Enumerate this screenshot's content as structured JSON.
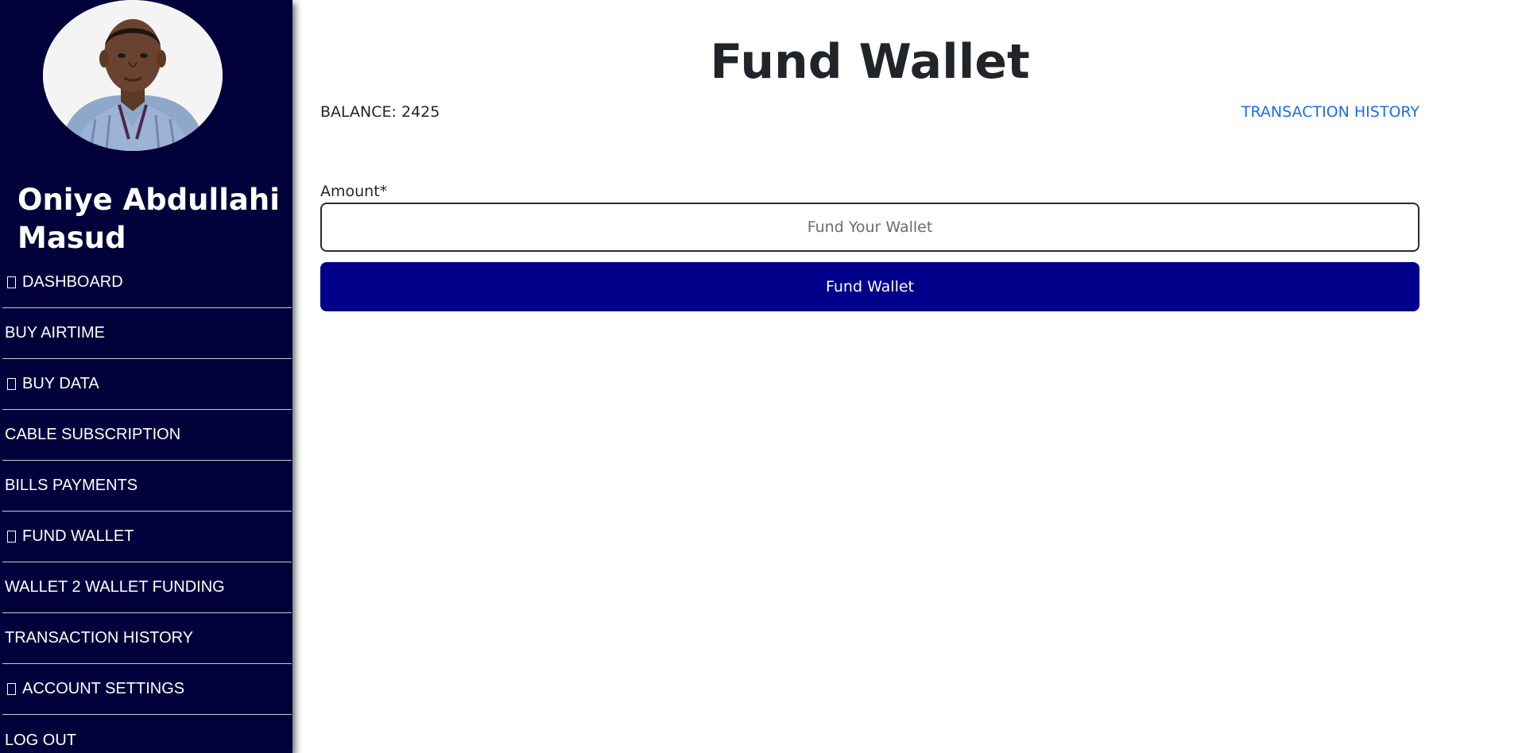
{
  "sidebar": {
    "user_name": "Oniye Abdullahi Masud",
    "colors": {
      "background": "#02003a",
      "text": "#ffffff"
    },
    "items": [
      {
        "label": "DASHBOARD",
        "icon": "missing-glyph-icon"
      },
      {
        "label": "BUY AIRTIME",
        "icon": null
      },
      {
        "label": "BUY DATA",
        "icon": "missing-glyph-icon"
      },
      {
        "label": "CABLE SUBSCRIPTION",
        "icon": null
      },
      {
        "label": "BILLS PAYMENTS",
        "icon": null
      },
      {
        "label": "FUND WALLET",
        "icon": "missing-glyph-icon"
      },
      {
        "label": "WALLET 2 WALLET FUNDING",
        "icon": null
      },
      {
        "label": "TRANSACTION HISTORY",
        "icon": null
      },
      {
        "label": "ACCOUNT SETTINGS",
        "icon": "missing-glyph-icon"
      },
      {
        "label": "LOG OUT",
        "icon": null
      }
    ]
  },
  "main": {
    "title": "Fund Wallet",
    "balance_label": "BALANCE:",
    "balance_value": "2425",
    "transaction_history_link": "TRANSACTION HISTORY",
    "form": {
      "amount_label": "Amount*",
      "amount_value": "",
      "amount_placeholder": "Fund Your Wallet",
      "submit_label": "Fund Wallet"
    },
    "colors": {
      "link": "#1a6ee8",
      "button": "#00008b",
      "button_text": "#ffffff"
    }
  }
}
